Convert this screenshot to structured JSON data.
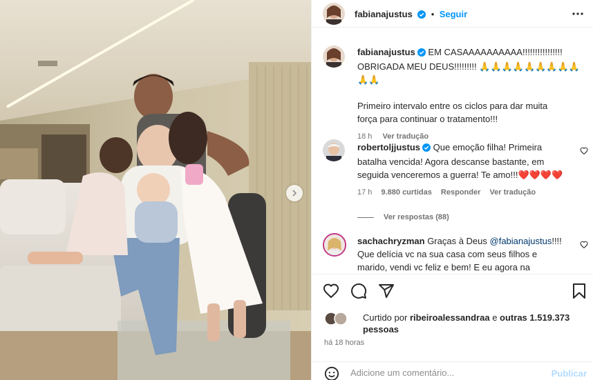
{
  "post": {
    "author": "fabianajustus",
    "follow_label": "Seguir",
    "separator": "•",
    "caption": {
      "author": "fabianajustus",
      "line1": "EM CASAAAAAAAAAA!!!!!!!!!!!!!!!!",
      "line2": "OBRIGADA MEU DEUS!!!!!!!!! 🙏🙏🙏🙏🙏🙏🙏🙏🙏🙏🙏",
      "para2_line1": "Primeiro intervalo entre os ciclos para dar muita",
      "para2_line2": "força para continuar o tratamento!!!",
      "time": "18 h",
      "translate": "Ver tradução"
    },
    "comments": [
      {
        "author": "robertoljjustus",
        "lines": [
          "Que emoção filha! Primeira",
          "batalha vencida! Agora descanse bastante, em",
          "seguida venceremos a guerra! Te amo!!!❤️❤️❤️❤️"
        ],
        "time": "17 h",
        "likes": "9.880 curtidas",
        "reply": "Responder",
        "translate": "Ver tradução",
        "view_replies": "Ver respostas (88)"
      },
      {
        "author": "sachachryzman",
        "lead": "Graças à Deus",
        "mention": "@fabianajustus",
        "mention_tail": "!!!!",
        "lines": [
          "Que delícia vc na sua casa com seus filhos e",
          "marido, vendi vc feliz e bem! E eu agora na"
        ]
      }
    ],
    "likes": {
      "prefix": "Curtido por",
      "user": "ribeiroalessandraa",
      "middle": "e",
      "others": "outras 1.519.373",
      "suffix": "pessoas"
    },
    "posted_ago": "há 18 horas",
    "comment_placeholder": "Adicione um comentário...",
    "publish_label": "Publicar"
  },
  "colors": {
    "accent": "#0095f6",
    "link": "#00376b",
    "verified": "#0095f6",
    "muted": "#737373",
    "publish_disabled": "#b3dbff"
  },
  "icons": [
    "more-icon",
    "verified-icon",
    "heart-icon",
    "comment-icon",
    "share-icon",
    "bookmark-icon",
    "emoji-icon",
    "chevron-right-icon"
  ]
}
